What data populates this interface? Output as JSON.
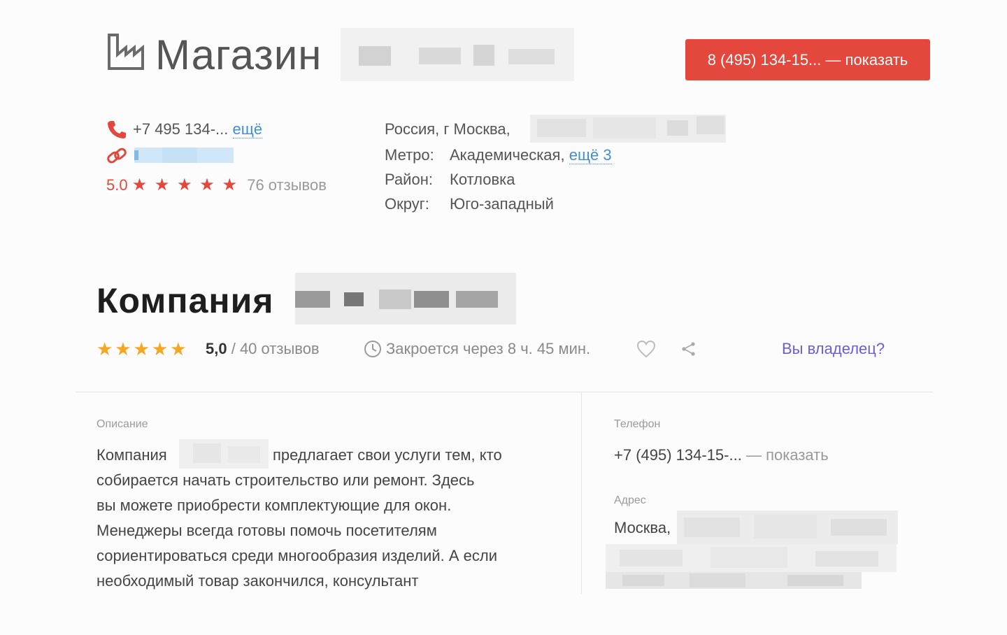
{
  "shop": {
    "title": "Магазин",
    "phone_button": "8 (495) 134-15... — показать",
    "phone_short": "+7 495 134-...",
    "phone_more": "ещё",
    "rating": "5.0",
    "stars": "★ ★ ★ ★ ★",
    "reviews": "76 отзывов",
    "rating_value": 5.0,
    "address": {
      "city": "Россия, г Москва,",
      "metro_label": "Метро:",
      "metro_value": "Академическая,",
      "metro_more": "ещё 3",
      "district_label": "Район:",
      "district_value": "Котловка",
      "okrug_label": "Округ:",
      "okrug_value": "Юго-западный"
    }
  },
  "company": {
    "title": "Компания",
    "stars": "★★★★★",
    "rating": "5,0",
    "rating_value": 5.0,
    "reviews": "/ 40 отзывов",
    "hours": "Закроется через 8 ч. 45 мин.",
    "owner_link": "Вы владелец?",
    "description_label": "Описание",
    "description_lines": [
      "Компания",
      "предлагает свои услуги тем, кто",
      "собирается начать строительство или ремонт. Здесь",
      "вы можете приобрести комплектующие для окон.",
      "Менеджеры всегда готовы помочь посетителям",
      "сориентироваться среди многообразия изделий. А если",
      "необходимый товар закончился, консультант"
    ],
    "phone_label": "Телефон",
    "phone_value": "+7 (495) 134-15-...",
    "phone_reveal": "— показать",
    "address_label": "Адрес",
    "address_value": "Москва,"
  },
  "icons": {
    "shop_logo": "factory-icon",
    "phone": "phone-icon",
    "link": "link-icon",
    "clock": "clock-icon",
    "heart": "heart-icon",
    "share": "share-icon"
  },
  "colors": {
    "accent_red": "#e4473c",
    "star_gold": "#f5a623",
    "link_blue": "#3f8fd6",
    "owner_purple": "#6c5dd3"
  }
}
